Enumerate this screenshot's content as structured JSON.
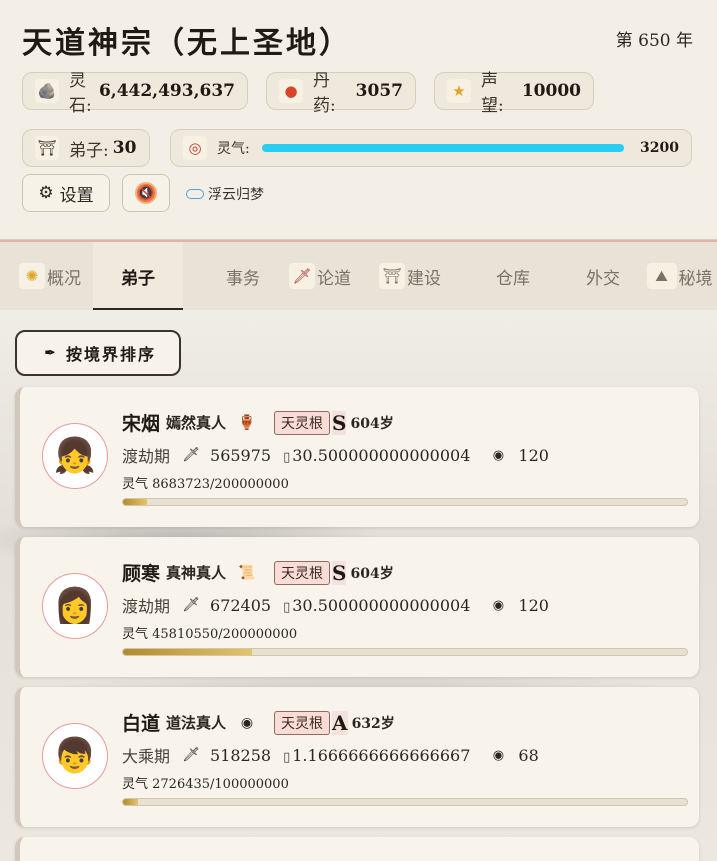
{
  "header": {
    "title": "天道神宗（无上圣地）",
    "year": "第 650 年",
    "resources": {
      "spirit_stone_label": "灵石:",
      "spirit_stone_value": "6,442,493,637",
      "pill_label": "丹药:",
      "pill_value": "3057",
      "prestige_label": "声望:",
      "prestige_value": "10000",
      "disciples_label": "弟子:",
      "disciples_value": "30",
      "qi_label": "灵气:",
      "qi_value": "3200",
      "qi_fill": 1.0
    },
    "settings_label": "设置",
    "music_label": "浮云归梦"
  },
  "tabs": [
    {
      "label": "概况",
      "icon": "sun-icon"
    },
    {
      "label": "弟子",
      "icon": ""
    },
    {
      "label": "事务",
      "icon": ""
    },
    {
      "label": "论道",
      "icon": "sword-icon"
    },
    {
      "label": "建设",
      "icon": "building-icon"
    },
    {
      "label": "仓库",
      "icon": ""
    },
    {
      "label": "外交",
      "icon": ""
    },
    {
      "label": "秘境",
      "icon": "mountain-icon"
    }
  ],
  "active_tab": "弟子",
  "sort_button": "按境界排序",
  "disciples": [
    {
      "name": "宋烟",
      "dao_title": "嫣然真人",
      "root": "天灵根",
      "grade": "S",
      "age": "604岁",
      "realm": "渡劫期",
      "power": "565975",
      "speed": "30.500000000000004",
      "stones": "120",
      "qi_text": "灵气 8683723/200000000",
      "qi_fraction": 0.043
    },
    {
      "name": "顾寒",
      "dao_title": "真神真人",
      "root": "天灵根",
      "grade": "S",
      "age": "604岁",
      "realm": "渡劫期",
      "power": "672405",
      "speed": "30.500000000000004",
      "stones": "120",
      "qi_text": "灵气 45810550/200000000",
      "qi_fraction": 0.229
    },
    {
      "name": "白道",
      "dao_title": "道法真人",
      "root": "天灵根",
      "grade": "A",
      "age": "632岁",
      "realm": "大乘期",
      "power": "518258",
      "speed": "1.1666666666666667",
      "stones": "68",
      "qi_text": "灵气 2726435/100000000",
      "qi_fraction": 0.027
    }
  ]
}
